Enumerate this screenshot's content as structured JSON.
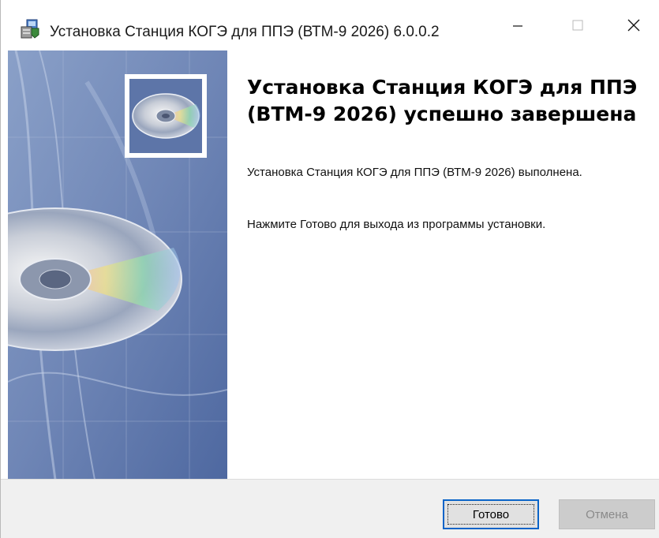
{
  "window": {
    "title": "Установка Станция КОГЭ для ППЭ (ВТМ-9 2026) 6.0.0.2",
    "minimize_icon": "minimize-icon",
    "maximize_icon": "maximize-icon",
    "close_icon": "close-icon"
  },
  "banner": {
    "image": "cd-disc-illustration",
    "thumbnail": "cd-disc-thumbnail"
  },
  "content": {
    "heading": "Установка Станция КОГЭ для ППЭ (ВТМ-9 2026) успешно завершена",
    "message_line1": "Установка Станция КОГЭ для ППЭ (ВТМ-9 2026) выполнена.",
    "message_line2": "Нажмите Готово для выхода из программы установки."
  },
  "buttons": {
    "finish_label": "Готово",
    "cancel_label": "Отмена",
    "cancel_disabled": true
  },
  "colors": {
    "banner_blue": "#6f86b6",
    "focus_border": "#0a64c8",
    "footer_bg": "#f0f0f0"
  }
}
